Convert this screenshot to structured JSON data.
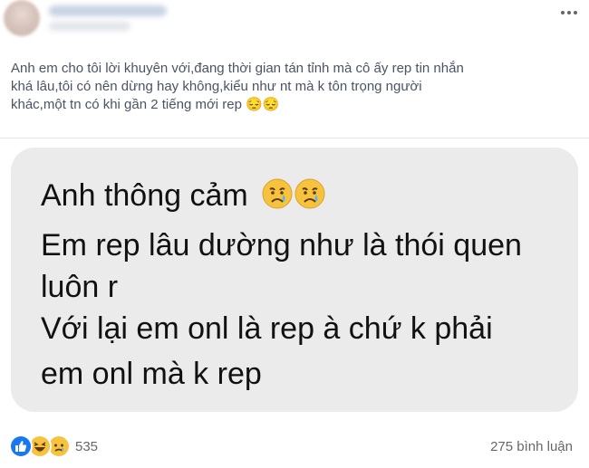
{
  "post": {
    "text": "Anh em cho tôi lời khuyên với,đang thời gian tán tỉnh mà cô ấy rep tin nhắn\nkhá lâu,tôi có nên dừng hay không,kiểu như nt mà k tôn trọng người\nkhác,một tn có khi gần 2 tiếng mới rep 😔😔"
  },
  "bubble": {
    "line1": "Anh thông cảm",
    "line2": "Em rep lâu dường như là thói quen",
    "line3": "luôn r",
    "line4": "Với lại em onl là rep à chứ k phải",
    "line5": "em onl mà k rep",
    "emoji_icons": [
      "crying-face-icon",
      "crying-face-icon"
    ]
  },
  "footer": {
    "reaction_icons": [
      "like-icon",
      "haha-icon",
      "sad-icon"
    ],
    "reaction_count": "535",
    "comment_count": "275 bình luận"
  },
  "colors": {
    "like_blue": "#1877f2",
    "emoji_yellow": "#f7c33f",
    "muted_text": "#65676b"
  }
}
